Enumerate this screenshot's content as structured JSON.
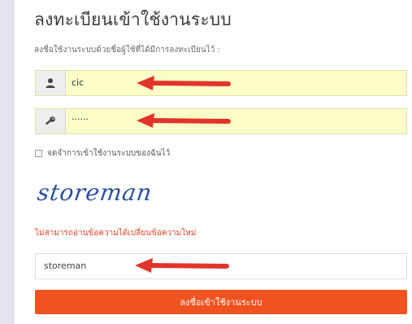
{
  "login": {
    "title": "ลงทะเบียนเข้าใช้งานระบบ",
    "subtitle": "ลงชื่อใช้งานระบบด้วยชื่อผู้ใช้ที่ได้มีการลงทะเบียนไว้ :",
    "username_value": "cic",
    "password_value": "······",
    "remember_label": "จดจำการเข้าใช้งานระบบของฉันไว้",
    "captcha_text": "storeman",
    "captcha_error": "ไม่สามารถอ่านข้อความได้เปลี่ยนข้อความใหม่",
    "captcha_input_value": "storeman",
    "submit_label": "ลงชื่อเข้าใช้งานระบบ"
  },
  "icons": {
    "username": "user-icon",
    "password": "key-icon",
    "annotation": "red-arrow-icon"
  },
  "colors": {
    "field_highlight": "#fbfcc8",
    "submit_button": "#f0531f",
    "error_text": "#e24628",
    "arrow": "#e2342a",
    "captcha_ink": "#2a4fa0"
  }
}
